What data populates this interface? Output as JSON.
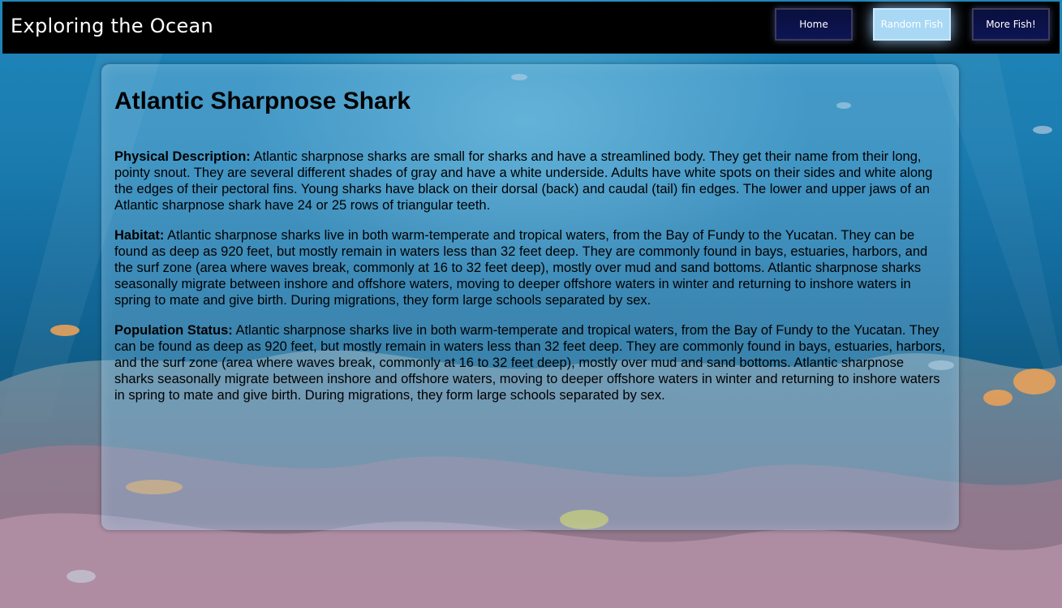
{
  "site": {
    "title": "Exploring the Ocean"
  },
  "nav": {
    "items": [
      {
        "label": "Home",
        "active": false
      },
      {
        "label": "Random Fish",
        "active": true
      },
      {
        "label": "More Fish!",
        "active": false
      }
    ]
  },
  "fish": {
    "name": "Atlantic Sharpnose Shark",
    "sections": [
      {
        "label": "Physical Description:",
        "text": "Atlantic sharpnose sharks are small for sharks and have a streamlined body. They get their name from their long, pointy snout. They are several different shades of gray and have a white underside. Adults have white spots on their sides and white along the edges of their pectoral fins. Young sharks have black on their dorsal (back) and caudal (tail) fin edges. The lower and upper jaws of an Atlantic sharpnose shark have 24 or 25 rows of triangular teeth."
      },
      {
        "label": "Habitat:",
        "text": "Atlantic sharpnose sharks live in both warm-temperate and tropical waters, from the Bay of Fundy to the Yucatan. They can be found as deep as 920 feet, but mostly remain in waters less than 32 feet deep. They are commonly found in bays, estuaries, harbors, and the surf zone (area where waves break, commonly at 16 to 32 feet deep), mostly over mud and sand bottoms. Atlantic sharpnose sharks seasonally migrate between inshore and offshore waters, moving to deeper offshore waters in winter and returning to inshore waters in spring to mate and give birth. During migrations, they form large schools separated by sex."
      },
      {
        "label": "Population Status:",
        "text": "Atlantic sharpnose sharks live in both warm-temperate and tropical waters, from the Bay of Fundy to the Yucatan. They can be found as deep as 920 feet, but mostly remain in waters less than 32 feet deep. They are commonly found in bays, estuaries, harbors, and the surf zone (area where waves break, commonly at 16 to 32 feet deep), mostly over mud and sand bottoms. Atlantic sharpnose sharks seasonally migrate between inshore and offshore waters, moving to deeper offshore waters in winter and returning to inshore waters in spring to mate and give birth. During migrations, they form large schools separated by sex."
      }
    ]
  },
  "colors": {
    "header_bg": "#000000",
    "nav_button_bg": "#0d1554",
    "nav_button_active_bg": "#a9d8f5",
    "water": "#1b7cb0"
  }
}
